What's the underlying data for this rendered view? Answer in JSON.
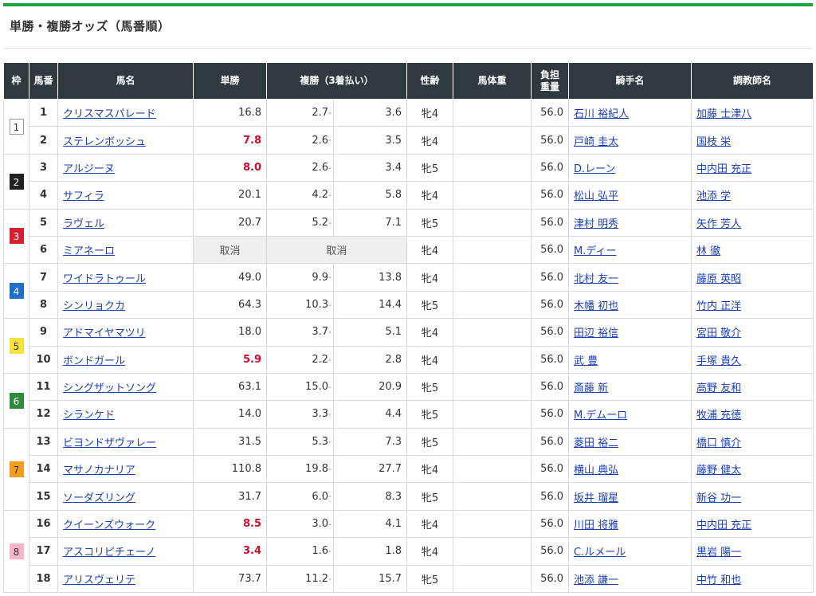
{
  "page": {
    "title": "単勝・複勝オッズ（馬番順）"
  },
  "headers": {
    "waku": "枠",
    "umaban": "馬番",
    "horse": "馬名",
    "win": "単勝",
    "place": "複勝（3着払い）",
    "sexage": "性齢",
    "body_weight": "馬体重",
    "burden_line1": "負担",
    "burden_line2": "重量",
    "jockey": "騎手名",
    "trainer": "調教師名"
  },
  "waku_colors": {
    "1": {
      "bg": "#ffffff",
      "fg": "#333333"
    },
    "2": {
      "bg": "#222222",
      "fg": "#ffffff"
    },
    "3": {
      "bg": "#d7202d",
      "fg": "#ffffff"
    },
    "4": {
      "bg": "#1f6fc9",
      "fg": "#ffffff"
    },
    "5": {
      "bg": "#f6e33a",
      "fg": "#333333"
    },
    "6": {
      "bg": "#2e8b3c",
      "fg": "#ffffff"
    },
    "7": {
      "bg": "#f39c1e",
      "fg": "#333333"
    },
    "8": {
      "bg": "#f7b6c8",
      "fg": "#333333"
    }
  },
  "rows": [
    {
      "waku": "1",
      "umaban": "1",
      "horse": "クリスマスパレード",
      "win": "16.8",
      "pmin": "2.7",
      "pmax": "3.6",
      "sexage": "牝4",
      "body": "",
      "weight": "56.0",
      "jockey": "石川 裕紀人",
      "trainer": "加藤 士津八",
      "fav": false,
      "scratched": false
    },
    {
      "waku": "1",
      "umaban": "2",
      "horse": "ステレンボッシュ",
      "win": "7.8",
      "pmin": "2.6",
      "pmax": "3.5",
      "sexage": "牝4",
      "body": "",
      "weight": "56.0",
      "jockey": "戸崎 圭太",
      "trainer": "国枝 栄",
      "fav": true,
      "scratched": false
    },
    {
      "waku": "2",
      "umaban": "3",
      "horse": "アルジーヌ",
      "win": "8.0",
      "pmin": "2.6",
      "pmax": "3.4",
      "sexage": "牝5",
      "body": "",
      "weight": "56.0",
      "jockey": "D.レーン",
      "trainer": "中内田 充正",
      "fav": true,
      "scratched": false
    },
    {
      "waku": "2",
      "umaban": "4",
      "horse": "サフィラ",
      "win": "20.1",
      "pmin": "4.2",
      "pmax": "5.8",
      "sexage": "牝4",
      "body": "",
      "weight": "56.0",
      "jockey": "松山 弘平",
      "trainer": "池添 学",
      "fav": false,
      "scratched": false
    },
    {
      "waku": "3",
      "umaban": "5",
      "horse": "ラヴェル",
      "win": "20.7",
      "pmin": "5.2",
      "pmax": "7.1",
      "sexage": "牝5",
      "body": "",
      "weight": "56.0",
      "jockey": "津村 明秀",
      "trainer": "矢作 芳人",
      "fav": false,
      "scratched": false
    },
    {
      "waku": "3",
      "umaban": "6",
      "horse": "ミアネーロ",
      "win": "取消",
      "pmin": "取消",
      "pmax": "",
      "sexage": "牝4",
      "body": "",
      "weight": "56.0",
      "jockey": "M.ディー",
      "trainer": "林 徹",
      "fav": false,
      "scratched": true
    },
    {
      "waku": "4",
      "umaban": "7",
      "horse": "ワイドラトゥール",
      "win": "49.0",
      "pmin": "9.9",
      "pmax": "13.8",
      "sexage": "牝4",
      "body": "",
      "weight": "56.0",
      "jockey": "北村 友一",
      "trainer": "藤原 英昭",
      "fav": false,
      "scratched": false
    },
    {
      "waku": "4",
      "umaban": "8",
      "horse": "シンリョクカ",
      "win": "64.3",
      "pmin": "10.3",
      "pmax": "14.4",
      "sexage": "牝5",
      "body": "",
      "weight": "56.0",
      "jockey": "木幡 初也",
      "trainer": "竹内 正洋",
      "fav": false,
      "scratched": false
    },
    {
      "waku": "5",
      "umaban": "9",
      "horse": "アドマイヤマツリ",
      "win": "18.0",
      "pmin": "3.7",
      "pmax": "5.1",
      "sexage": "牝4",
      "body": "",
      "weight": "56.0",
      "jockey": "田辺 裕信",
      "trainer": "宮田 敬介",
      "fav": false,
      "scratched": false
    },
    {
      "waku": "5",
      "umaban": "10",
      "horse": "ボンドガール",
      "win": "5.9",
      "pmin": "2.2",
      "pmax": "2.8",
      "sexage": "牝4",
      "body": "",
      "weight": "56.0",
      "jockey": "武 豊",
      "trainer": "手塚 貴久",
      "fav": true,
      "scratched": false
    },
    {
      "waku": "6",
      "umaban": "11",
      "horse": "シングザットソング",
      "win": "63.1",
      "pmin": "15.0",
      "pmax": "20.9",
      "sexage": "牝5",
      "body": "",
      "weight": "56.0",
      "jockey": "斎藤 新",
      "trainer": "高野 友和",
      "fav": false,
      "scratched": false
    },
    {
      "waku": "6",
      "umaban": "12",
      "horse": "シランケド",
      "win": "14.0",
      "pmin": "3.3",
      "pmax": "4.4",
      "sexage": "牝5",
      "body": "",
      "weight": "56.0",
      "jockey": "M.デムーロ",
      "trainer": "牧浦 充徳",
      "fav": false,
      "scratched": false
    },
    {
      "waku": "7",
      "umaban": "13",
      "horse": "ビヨンドザヴァレー",
      "win": "31.5",
      "pmin": "5.3",
      "pmax": "7.3",
      "sexage": "牝5",
      "body": "",
      "weight": "56.0",
      "jockey": "菱田 裕二",
      "trainer": "橋口 慎介",
      "fav": false,
      "scratched": false
    },
    {
      "waku": "7",
      "umaban": "14",
      "horse": "マサノカナリア",
      "win": "110.8",
      "pmin": "19.8",
      "pmax": "27.7",
      "sexage": "牝4",
      "body": "",
      "weight": "56.0",
      "jockey": "横山 典弘",
      "trainer": "藤野 健太",
      "fav": false,
      "scratched": false
    },
    {
      "waku": "7",
      "umaban": "15",
      "horse": "ソーダズリング",
      "win": "31.7",
      "pmin": "6.0",
      "pmax": "8.3",
      "sexage": "牝5",
      "body": "",
      "weight": "56.0",
      "jockey": "坂井 瑠星",
      "trainer": "新谷 功一",
      "fav": false,
      "scratched": false
    },
    {
      "waku": "8",
      "umaban": "16",
      "horse": "クイーンズウォーク",
      "win": "8.5",
      "pmin": "3.0",
      "pmax": "4.1",
      "sexage": "牝4",
      "body": "",
      "weight": "56.0",
      "jockey": "川田 将雅",
      "trainer": "中内田 充正",
      "fav": true,
      "scratched": false
    },
    {
      "waku": "8",
      "umaban": "17",
      "horse": "アスコリピチェーノ",
      "win": "3.4",
      "pmin": "1.6",
      "pmax": "1.8",
      "sexage": "牝4",
      "body": "",
      "weight": "56.0",
      "jockey": "C.ルメール",
      "trainer": "黒岩 陽一",
      "fav": true,
      "scratched": false
    },
    {
      "waku": "8",
      "umaban": "18",
      "horse": "アリスヴェリテ",
      "win": "73.7",
      "pmin": "11.2",
      "pmax": "15.7",
      "sexage": "牝5",
      "body": "",
      "weight": "56.0",
      "jockey": "池添 謙一",
      "trainer": "中竹 和也",
      "fav": false,
      "scratched": false
    }
  ]
}
